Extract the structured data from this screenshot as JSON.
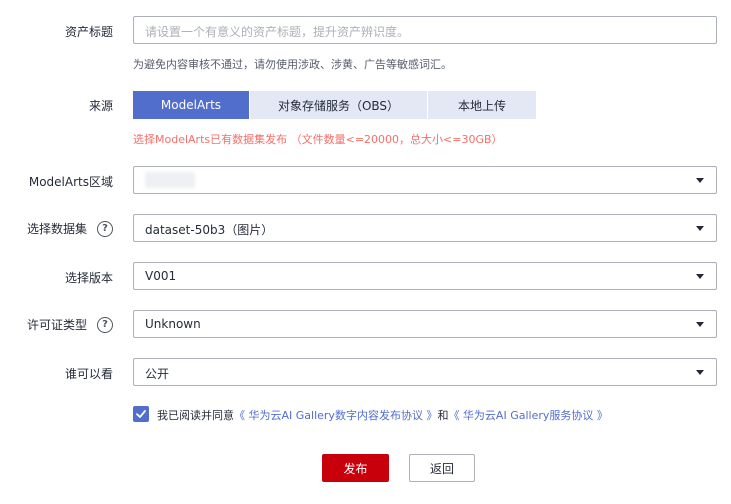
{
  "form": {
    "title": {
      "label": "资产标题",
      "placeholder": "请设置一个有意义的资产标题，提升资产辨识度。",
      "hint": "为避免内容审核不通过，请勿使用涉政、涉黄、广告等敏感词汇。"
    },
    "source": {
      "label": "来源",
      "options": [
        "ModelArts",
        "对象存储服务（OBS）",
        "本地上传"
      ],
      "selected": "ModelArts",
      "note": "选择ModelArts已有数据集发布 （文件数量<=20000，总大小<=30GB）"
    },
    "region": {
      "label": "ModelArts区域",
      "value": ""
    },
    "dataset": {
      "label": "选择数据集",
      "value": "dataset-50b3（图片）"
    },
    "version": {
      "label": "选择版本",
      "value": "V001"
    },
    "license": {
      "label": "许可证类型",
      "value": "Unknown"
    },
    "visibility": {
      "label": "谁可以看",
      "value": "公开"
    },
    "agreement": {
      "checked": true,
      "prefix": "我已阅读并同意",
      "link1": "《 华为云AI Gallery数字内容发布协议 》",
      "and": "和",
      "link2": "《 华为云AI Gallery服务协议 》"
    }
  },
  "actions": {
    "publish": "发布",
    "back": "返回"
  },
  "colors": {
    "accent": "#526ecc",
    "primary_button": "#c7000b",
    "warning": "#f66f6a"
  },
  "icons": {
    "help": "question-circle-icon",
    "caret": "caret-down-icon",
    "check": "check-icon"
  }
}
